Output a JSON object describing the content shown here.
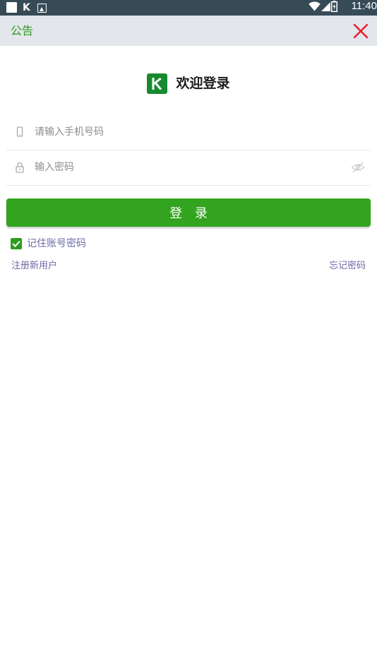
{
  "status_bar": {
    "time": "11:40",
    "icons": [
      "notification-square-icon",
      "k-app-icon",
      "photo-icon",
      "wifi-icon",
      "signal-icon",
      "battery-icon"
    ]
  },
  "notice_bar": {
    "label": "公告",
    "close_icon": "close-icon"
  },
  "header": {
    "logo_letter": "K",
    "title": "欢迎登录"
  },
  "form": {
    "phone_placeholder": "请输入手机号码",
    "phone_value": "",
    "password_placeholder": "输入密码",
    "password_value": "",
    "login_label": "登 录",
    "remember_label": "记住账号密码",
    "remember_checked": true
  },
  "links": {
    "register": "注册新用户",
    "forgot": "忘记密码"
  },
  "colors": {
    "status_bar": "#374b57",
    "notice_bg": "#e3e6ea",
    "accent_green": "#33a41f",
    "logo_green": "#178a2f",
    "close_red": "#e8202a",
    "link_purple": "#6d6aa8"
  }
}
